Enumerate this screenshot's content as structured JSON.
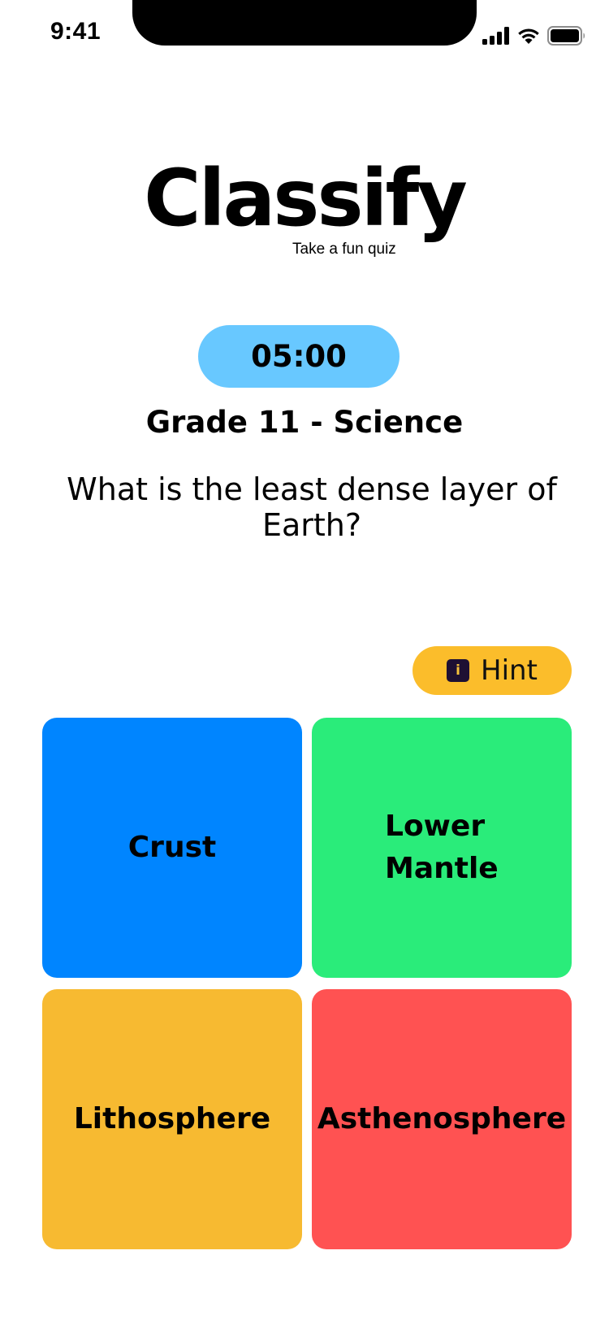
{
  "status_bar": {
    "time": "9:41",
    "icons": [
      "cellular-signal-icon",
      "wifi-icon",
      "battery-icon"
    ]
  },
  "logo": {
    "title": "Classify",
    "subtitle": "Take a fun quiz"
  },
  "timer": "05:00",
  "grade": "Grade 11 - Science",
  "question": "What is the least dense layer of Earth?",
  "hint": {
    "label": "Hint",
    "icon_text": "i",
    "icon": "info-icon"
  },
  "answers": [
    {
      "label": "Crust",
      "color": "#0085ff"
    },
    {
      "label": "Lower Mantle",
      "color": "#2aec7a"
    },
    {
      "label": "Lithosphere",
      "color": "#f7ba31"
    },
    {
      "label": "Asthenosphere",
      "color": "#ff5252"
    }
  ],
  "colors": {
    "timer_bg": "#68c8ff",
    "hint_bg": "#fbbd2b"
  }
}
